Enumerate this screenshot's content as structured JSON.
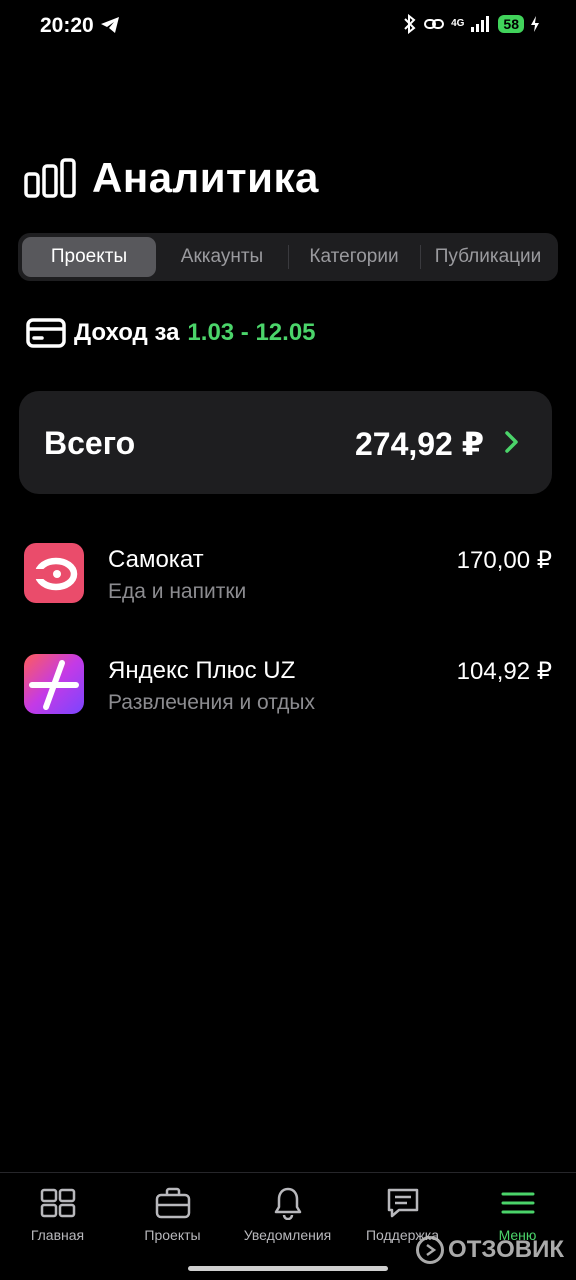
{
  "status_bar": {
    "time": "20:20",
    "network": "4G",
    "battery": "58"
  },
  "header": {
    "title": "Аналитика"
  },
  "tabs": [
    {
      "label": "Проекты",
      "active": true
    },
    {
      "label": "Аккаунты",
      "active": false
    },
    {
      "label": "Категории",
      "active": false
    },
    {
      "label": "Публикации",
      "active": false
    }
  ],
  "income": {
    "label": "Доход за",
    "period": "1.03 - 12.05"
  },
  "total": {
    "label": "Всего",
    "value": "274,92 ₽"
  },
  "projects": [
    {
      "name": "Самокат",
      "category": "Еда и напитки",
      "amount": "170,00 ₽",
      "icon": "samokat-logo-icon"
    },
    {
      "name": "Яндекс Плюс UZ",
      "category": "Развлечения и отдых",
      "amount": "104,92 ₽",
      "icon": "yandex-plus-logo-icon"
    }
  ],
  "bottom_nav": [
    {
      "label": "Главная",
      "icon": "grid-icon"
    },
    {
      "label": "Проекты",
      "icon": "briefcase-icon"
    },
    {
      "label": "Уведомления",
      "icon": "bell-icon"
    },
    {
      "label": "Поддержка",
      "icon": "chat-icon"
    },
    {
      "label": "Меню",
      "icon": "menu-icon",
      "active": true
    }
  ],
  "watermark": {
    "text": "ОТЗОВИК"
  },
  "colors": {
    "accent": "#4bd46a",
    "card": "#1e1e20",
    "background": "#000000"
  }
}
